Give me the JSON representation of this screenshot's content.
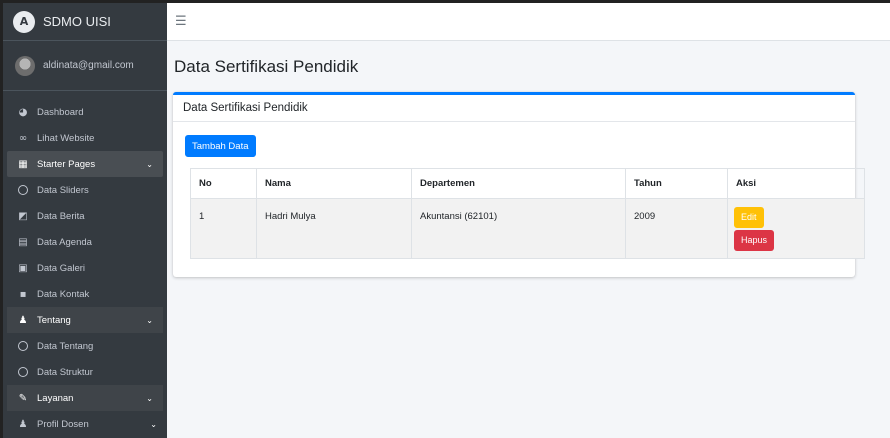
{
  "brand": {
    "name": "SDMO UISI"
  },
  "user": {
    "email": "aldinata@gmail.com"
  },
  "sidebar": {
    "items": [
      {
        "label": "Dashboard",
        "icon": "tachometer-icon"
      },
      {
        "label": "Lihat Website",
        "icon": "link-icon"
      },
      {
        "label": "Starter Pages",
        "icon": "th-icon",
        "expanded": true
      },
      {
        "label": "Data Sliders",
        "icon": "circle-icon"
      },
      {
        "label": "Data Berita",
        "icon": "image-icon"
      },
      {
        "label": "Data Agenda",
        "icon": "calendar-icon"
      },
      {
        "label": "Data Galeri",
        "icon": "photo-icon"
      },
      {
        "label": "Data Kontak",
        "icon": "contact-icon"
      },
      {
        "label": "Tentang",
        "icon": "user-icon"
      },
      {
        "label": "Data Tentang",
        "icon": "circle-icon"
      },
      {
        "label": "Data Struktur",
        "icon": "circle-icon"
      },
      {
        "label": "Layanan",
        "icon": "edit-icon"
      },
      {
        "label": "Profil Dosen",
        "icon": "user-icon"
      }
    ]
  },
  "topbar": {
    "menu_icon": "hamburger-icon"
  },
  "page": {
    "title": "Data Sertifikasi Pendidik"
  },
  "card": {
    "title": "Data Sertifikasi Pendidik",
    "add_button": "Tambah Data"
  },
  "table": {
    "headers": [
      "No",
      "Nama",
      "Departemen",
      "Tahun",
      "Aksi"
    ],
    "rows": [
      {
        "no": "1",
        "nama": "Hadri Mulya",
        "departemen": "Akuntansi (62101)",
        "tahun": "2009",
        "edit": "Edit",
        "hapus": "Hapus"
      }
    ]
  },
  "colors": {
    "primary": "#007bff",
    "warning": "#ffc107",
    "danger": "#dc3545",
    "sidebar": "#343a40"
  }
}
